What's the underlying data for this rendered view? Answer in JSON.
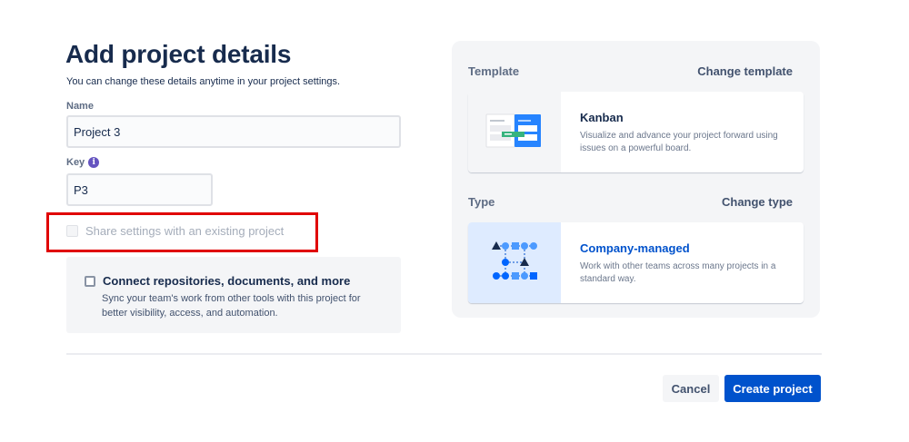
{
  "header": {
    "title": "Add project details",
    "subtitle": "You can change these details anytime in your project settings."
  },
  "form": {
    "name_label": "Name",
    "name_value": "Project 3",
    "key_label": "Key",
    "key_info_icon": "info-icon",
    "key_value": "P3",
    "share_label": "Share settings with an existing project",
    "connect_title": "Connect repositories, documents, and more",
    "connect_desc": "Sync your team's work from other tools with this project for better visibility, access, and automation."
  },
  "template": {
    "heading": "Template",
    "change_label": "Change template",
    "name": "Kanban",
    "description": "Visualize and advance your project forward using issues on a powerful board.",
    "icon": "kanban-board-illustration"
  },
  "type": {
    "heading": "Type",
    "change_label": "Change type",
    "name": "Company-managed",
    "description": "Work with other teams across many projects in a standard way.",
    "icon": "company-managed-illustration"
  },
  "actions": {
    "cancel_label": "Cancel",
    "create_label": "Create project"
  },
  "colors": {
    "primary": "#0052cc",
    "highlight": "#e00000",
    "info": "#6554c0"
  }
}
